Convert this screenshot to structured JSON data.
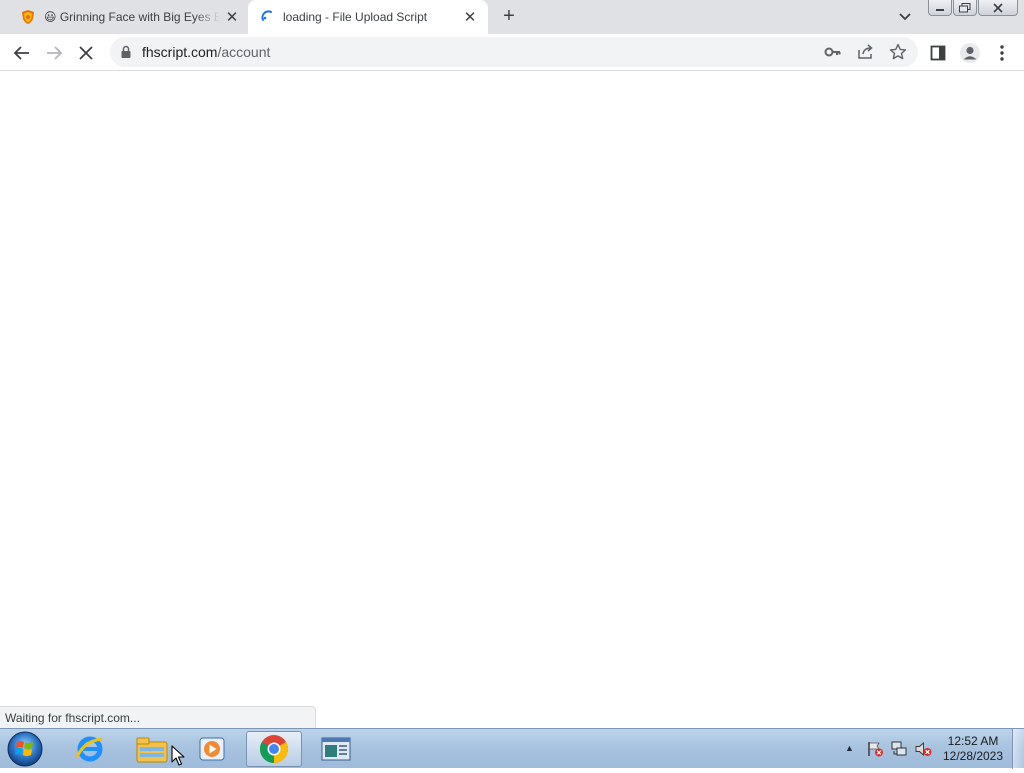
{
  "tabs": [
    {
      "title": "😃 Grinning Face with Big Eyes Emoji",
      "icon": "shield-favicon-icon",
      "active": false
    },
    {
      "title": "loading - File Upload Script",
      "icon": "loading-spinner-icon",
      "active": true
    }
  ],
  "toolbar": {
    "url_domain": "fhscript.com",
    "url_path": "/account"
  },
  "status": {
    "text": "Waiting for fhscript.com..."
  },
  "taskbar": {
    "time": "12:52 AM",
    "date": "12/28/2023"
  },
  "colors": {
    "tabstrip": "#dfe1e5",
    "omnibox": "#f1f3f4",
    "taskbar": "#a7c2df",
    "link_blue": "#1a73e8"
  }
}
